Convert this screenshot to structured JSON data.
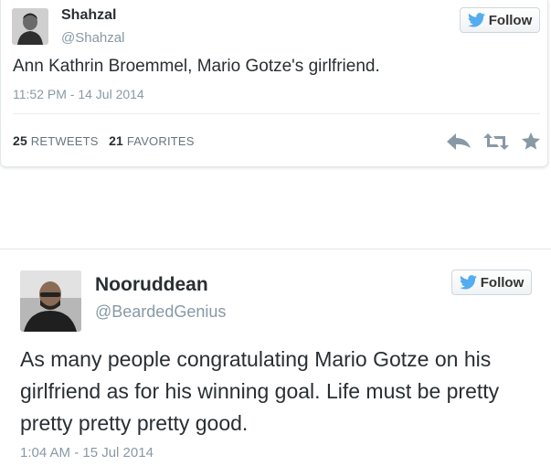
{
  "tweet1": {
    "name": "Shahzal",
    "handle": "@Shahzal",
    "follow_label": "Follow",
    "text": "Ann Kathrin Broemmel, Mario Gotze's girlfriend.",
    "timestamp": "11:52 PM - 14 Jul 2014",
    "retweets_count": "25",
    "retweets_label": "RETWEETS",
    "favorites_count": "21",
    "favorites_label": "FAVORITES"
  },
  "tweet2": {
    "name": "Nooruddean",
    "handle": "@BeardedGenius",
    "follow_label": "Follow",
    "text": "As many people congratulating Mario Gotze on his girlfriend as for his winning goal. Life must be pretty pretty pretty pretty good.",
    "timestamp": "1:04 AM - 15 Jul 2014"
  },
  "colors": {
    "twitter_blue": "#55acee",
    "meta_gray": "#8899a6",
    "icon_gray": "#8899a6"
  },
  "icons": [
    "twitter-bird-icon",
    "reply-icon",
    "retweet-icon",
    "favorite-star-icon"
  ]
}
